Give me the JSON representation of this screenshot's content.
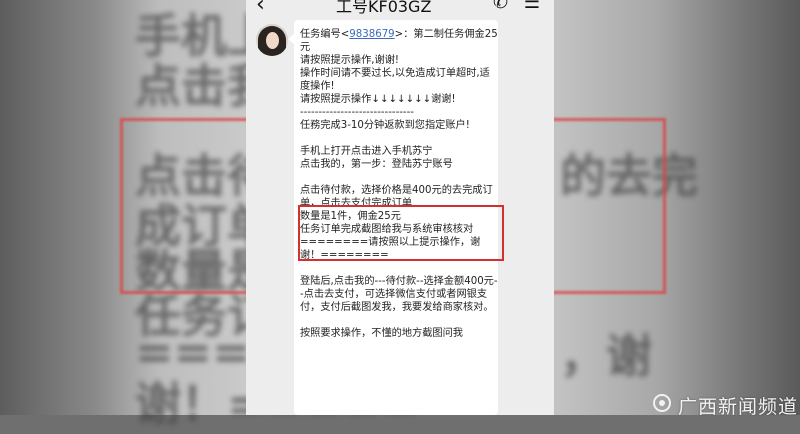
{
  "chat": {
    "title": "工号KF03GZ",
    "back_glyph": "‹",
    "call_glyph": "✆",
    "menu_glyph": "☰"
  },
  "message": {
    "line1_prefix": "任务编号<",
    "task_id": "9838679",
    "line1_suffix": ">：第二制任务佣金25元",
    "body": "请按照提示操作,谢谢!\n操作时间请不要过长,以免造成订单超时,适度操作!\n请按照提示操作↓↓↓↓↓↓↓谢谢!\n-------------------------------\n任務完成3-10分钟返款到您指定账户!\n\n手机上打开点击进入手机苏宁\n点击我的，第一步：登陆苏宁账号\n\n点击待付款，选择价格是400元的去完成订单，点击去支付完成订单\n数量是1件，佣金25元\n任务订单完成截图给我与系统审核核对\n========请按照以上提示操作，谢谢！========\n\n登陆后,点击我的---待付款--选择金额400元--点击去支付，可选择微信支付或者网银支付，支付后截图发我，我要发给商家核对。\n\n按照要求操作，不懂的地方截图问我"
  },
  "background": {
    "line1": "手机上打",
    "line2": "点击我的",
    "line3": "点击待付",
    "line4": "成订单，",
    "line5": "数量是1件",
    "line6": "任务订单",
    "line7": "=======",
    "line8": "谢！=====",
    "right1": "的去完",
    "right2": "，谢"
  },
  "watermark": {
    "text": "广西新闻频道"
  }
}
